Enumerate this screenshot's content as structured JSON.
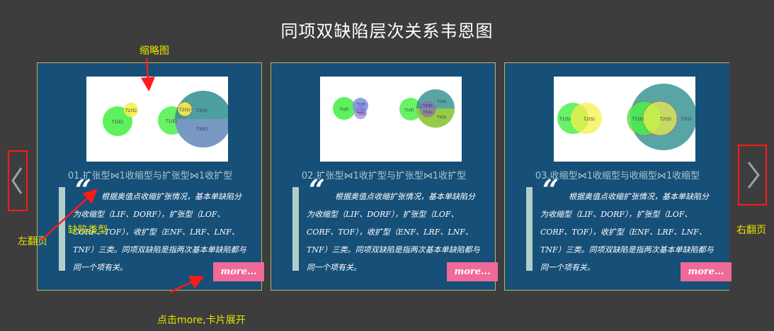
{
  "title": "同项双缺陷层次关系韦恩图",
  "cards": [
    {
      "title": "01.扩张型⋈1收缩型与扩张型⋈1收扩型",
      "description": "根据奥值点收缩扩张情况，基本单缺陷分为收缩型（LIF、DORF），扩张型（LOF、CORF、TOF），收扩型（ENF、LRF、LNF、TNF）三类。同项双缺陷是指两次基本单缺陷都与同一个项有关。",
      "more_label": "more...",
      "thumbnail_labels": [
        "T1(E)",
        "T2(S)",
        "T1(E)",
        "T2(S)",
        "T3(S)",
        "T3(E)"
      ]
    },
    {
      "title": "02.扩张型⋈1收扩型与扩张型⋈1收扩型",
      "description": "根据奥值点收缩扩张情况，基本单缺陷分为收缩型（LIF、DORF），扩张型（LOF、CORF、TOF），收扩型（ENF、LRF、LNF、TNF）三类。同项双缺陷是指两次基本单缺陷都与同一个项有关。",
      "more_label": "more...",
      "thumbnail_labels": [
        "T1(E)",
        "T2(E)",
        "T3(S)",
        "T1(E)",
        "T3(E)",
        "T2(E)",
        "T3(S)",
        "T3(S)"
      ]
    },
    {
      "title": "03.收缩型⋈1收缩型与收缩型⋈1收缩型",
      "description": "根据奥值点收缩扩张情况，基本单缺陷分为收缩型（LIF、DORF），扩张型（LOF、CORF、TOF），收扩型（ENF、LRF、LNF、TNF）三类。同项双缺陷是指两次基本单缺陷都与同一个项有关。",
      "more_label": "more...",
      "thumbnail_labels": [
        "T1(S)",
        "T2(S)",
        "T1(S)",
        "T2(S)",
        "T3(S)"
      ]
    }
  ],
  "annotations": {
    "thumbnail": "缩略图",
    "defect_type": "缺陷类型",
    "left_page": "左翻页",
    "right_page": "右翻页",
    "more_hint": "点击more,卡片展开"
  },
  "icons": {
    "prev": "chevron-left-icon",
    "next": "chevron-right-icon",
    "quote": "quote-icon"
  },
  "colors": {
    "background": "#3d3d3d",
    "card": "#164f78",
    "more_button": "#f06a97",
    "annotation": "#e7e300",
    "highlight": "#ff1a1a"
  }
}
